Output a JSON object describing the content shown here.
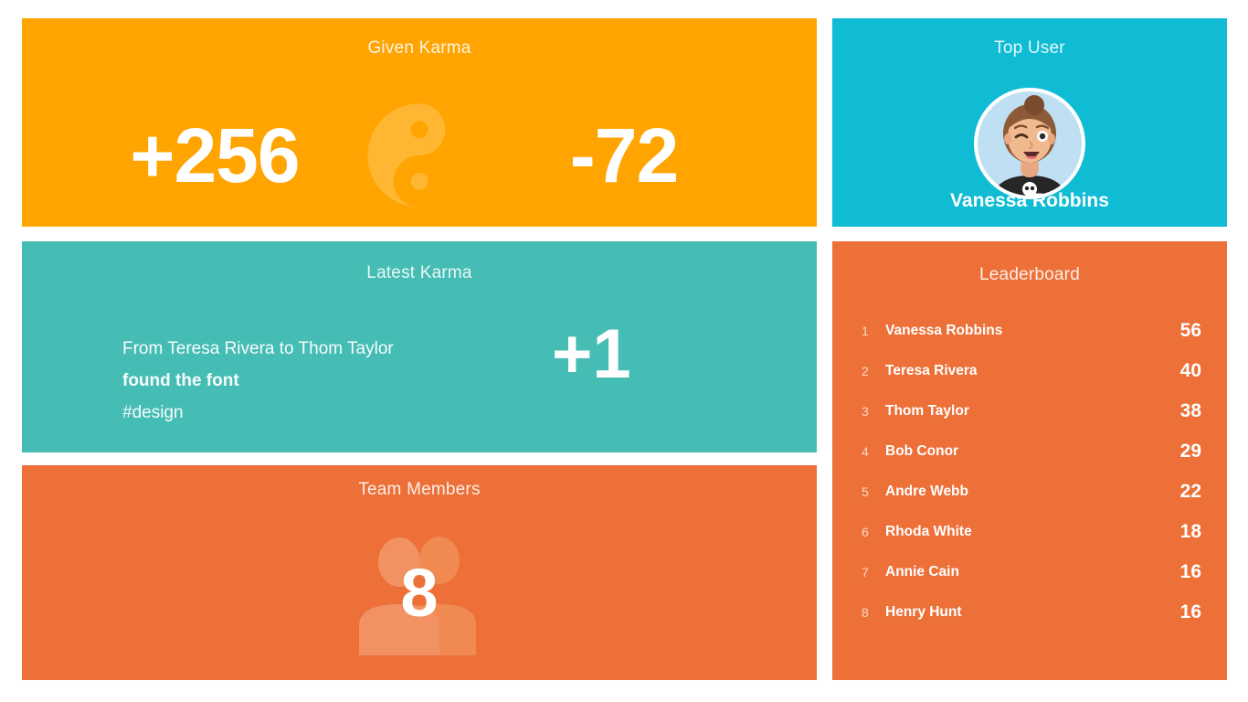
{
  "given_karma": {
    "title": "Given Karma",
    "positive": "+256",
    "negative": "-72",
    "icon": "yin-yang-icon",
    "bg_color": "#FFA400"
  },
  "top_user": {
    "title": "Top User",
    "name": "Vanessa Robbins",
    "avatar": "woman-wink-bun-avatar",
    "bg_color": "#0FBCD4"
  },
  "latest_karma": {
    "title": "Latest Karma",
    "from_to": "From Teresa Rivera to Thom Taylor",
    "message": "found the font",
    "tag": "#design",
    "score": "+1",
    "bg_color": "#45BDB4"
  },
  "team_members": {
    "title": "Team Members",
    "count": "8",
    "icon": "two-people-icon",
    "bg_color": "#EC7038"
  },
  "leaderboard": {
    "title": "Leaderboard",
    "bg_color": "#EC7038",
    "rows": [
      {
        "rank": "1",
        "name": "Vanessa Robbins",
        "score": "56"
      },
      {
        "rank": "2",
        "name": "Teresa Rivera",
        "score": "40"
      },
      {
        "rank": "3",
        "name": "Thom Taylor",
        "score": "38"
      },
      {
        "rank": "4",
        "name": "Bob Conor",
        "score": "29"
      },
      {
        "rank": "5",
        "name": "Andre Webb",
        "score": "22"
      },
      {
        "rank": "6",
        "name": "Rhoda White",
        "score": "18"
      },
      {
        "rank": "7",
        "name": "Annie Cain",
        "score": "16"
      },
      {
        "rank": "8",
        "name": "Henry Hunt",
        "score": "16"
      }
    ]
  }
}
